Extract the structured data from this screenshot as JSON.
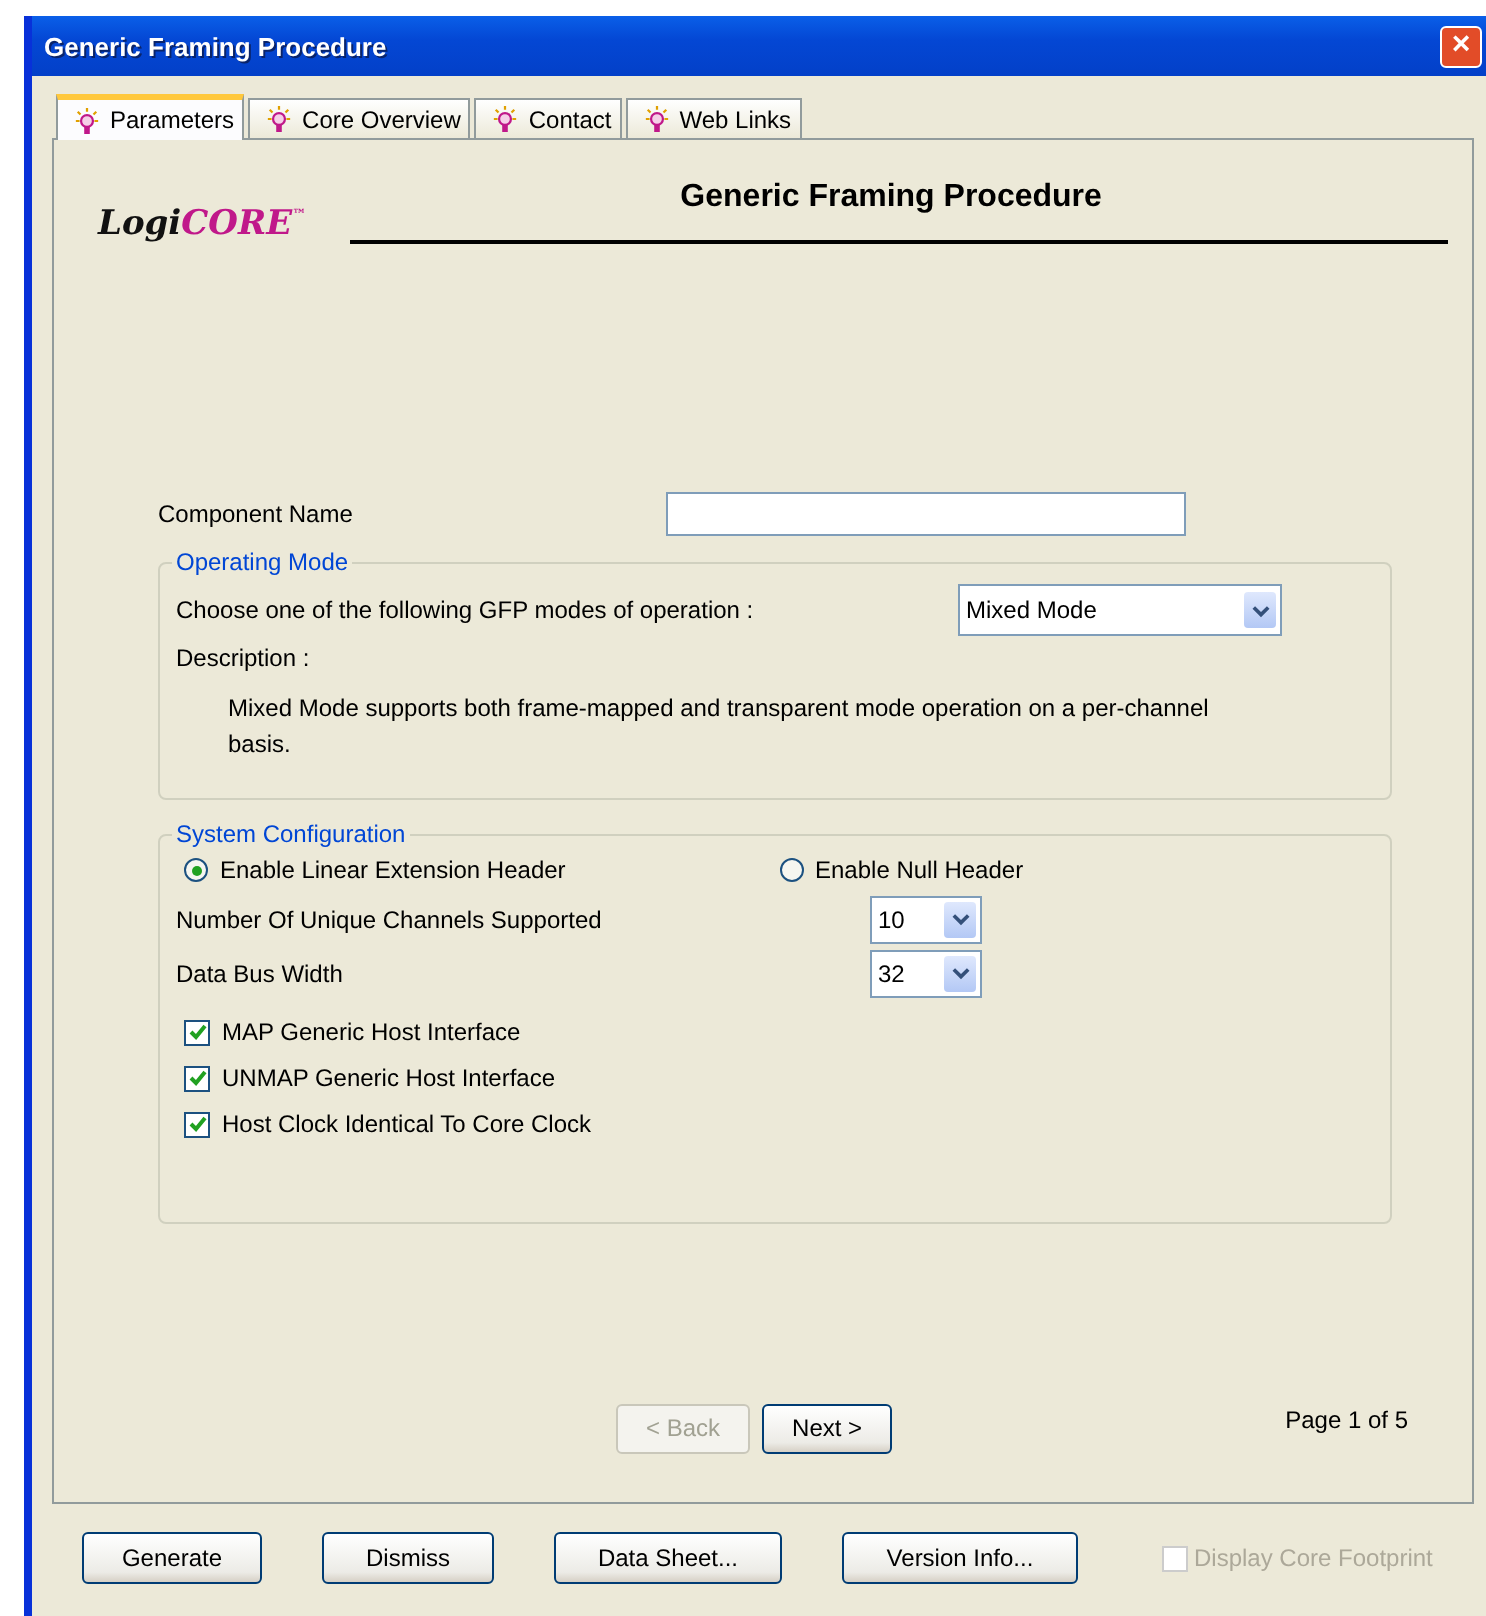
{
  "window": {
    "title": "Generic Framing Procedure",
    "close": "×"
  },
  "tabs": [
    {
      "label": "Parameters",
      "selected": true
    },
    {
      "label": "Core Overview",
      "selected": false
    },
    {
      "label": "Contact",
      "selected": false
    },
    {
      "label": "Web Links",
      "selected": false
    }
  ],
  "logo": {
    "part_1": "Logi",
    "part_2": "CORE",
    "mark": "™"
  },
  "heading": "Generic Framing Procedure",
  "component_name": {
    "label": "Component Name"
  },
  "operating_mode": {
    "legend": "Operating Mode",
    "prompt": "Choose one of the following GFP modes of operation :",
    "mode": "Mixed Mode",
    "description_label": "Description :",
    "description": "Mixed Mode supports both frame-mapped and transparent mode operation on a per-channel basis."
  },
  "system_configuration": {
    "legend": "System Configuration",
    "radios": [
      {
        "label": "Enable Linear Extension Header",
        "selected": true
      },
      {
        "label": "Enable Null Header",
        "selected": false
      }
    ],
    "selects": [
      {
        "label": "Number Of Unique Channels Supported",
        "value": "10"
      },
      {
        "label": "Data Bus Width",
        "value": "32"
      }
    ],
    "checkboxes": [
      {
        "label": "MAP Generic Host Interface",
        "checked": true
      },
      {
        "label": "UNMAP Generic Host Interface",
        "checked": true
      },
      {
        "label": "Host Clock Identical To Core Clock",
        "checked": true
      }
    ]
  },
  "nav": [
    {
      "label": "< Back",
      "disabled": true
    },
    {
      "label": "Next >",
      "disabled": false
    }
  ],
  "page_indicator": "Page 1 of 5",
  "buttons": [
    "Generate",
    "Dismiss",
    "Data Sheet...",
    "Version Info..."
  ],
  "footprint": {
    "label": "Display Core Footprint",
    "checked": false,
    "disabled": true
  }
}
